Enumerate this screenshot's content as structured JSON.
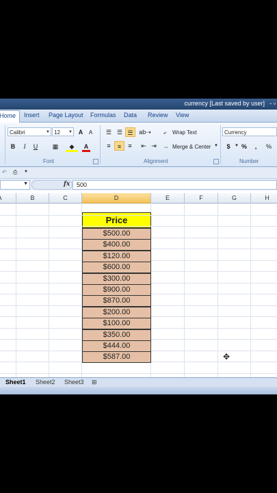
{
  "window": {
    "title": "currency [Last saved by user]",
    "controls": "- ▫"
  },
  "tabs": [
    "Home",
    "Insert",
    "Page Layout",
    "Formulas",
    "Data",
    "Review",
    "View"
  ],
  "ribbon": {
    "font": {
      "name": "Calibri",
      "size": "12",
      "grow": "A",
      "shrink": "A",
      "bold": "B",
      "italic": "I",
      "underline": "U",
      "font_color": "A",
      "group_label": "Font"
    },
    "alignment": {
      "wrap_text": "Wrap Text",
      "merge_center": "Merge & Center",
      "group_label": "Alignment"
    },
    "number": {
      "format": "Currency",
      "currency": "$",
      "percent": "%",
      "comma": ",",
      "group_label": "Number"
    }
  },
  "formula_bar": {
    "name_box": "",
    "fx": "fx",
    "value": "500"
  },
  "columns": [
    "A",
    "B",
    "C",
    "D",
    "E",
    "F",
    "G",
    "H"
  ],
  "selected_column": "D",
  "table": {
    "header": "Price",
    "values": [
      "$500.00",
      "$400.00",
      "$120.00",
      "$600.00",
      "$300.00",
      "$900.00",
      "$870.00",
      "$200.00",
      "$100.00",
      "$350.00",
      "$444.00",
      "$587.00"
    ]
  },
  "sheets": [
    "Sheet1",
    "Sheet2",
    "Sheet3"
  ],
  "active_sheet": "Sheet1",
  "colors": {
    "header_fill": "#ffff00",
    "price_fill": "#e5c0a6",
    "ribbon_accent": "#f9d98b"
  }
}
